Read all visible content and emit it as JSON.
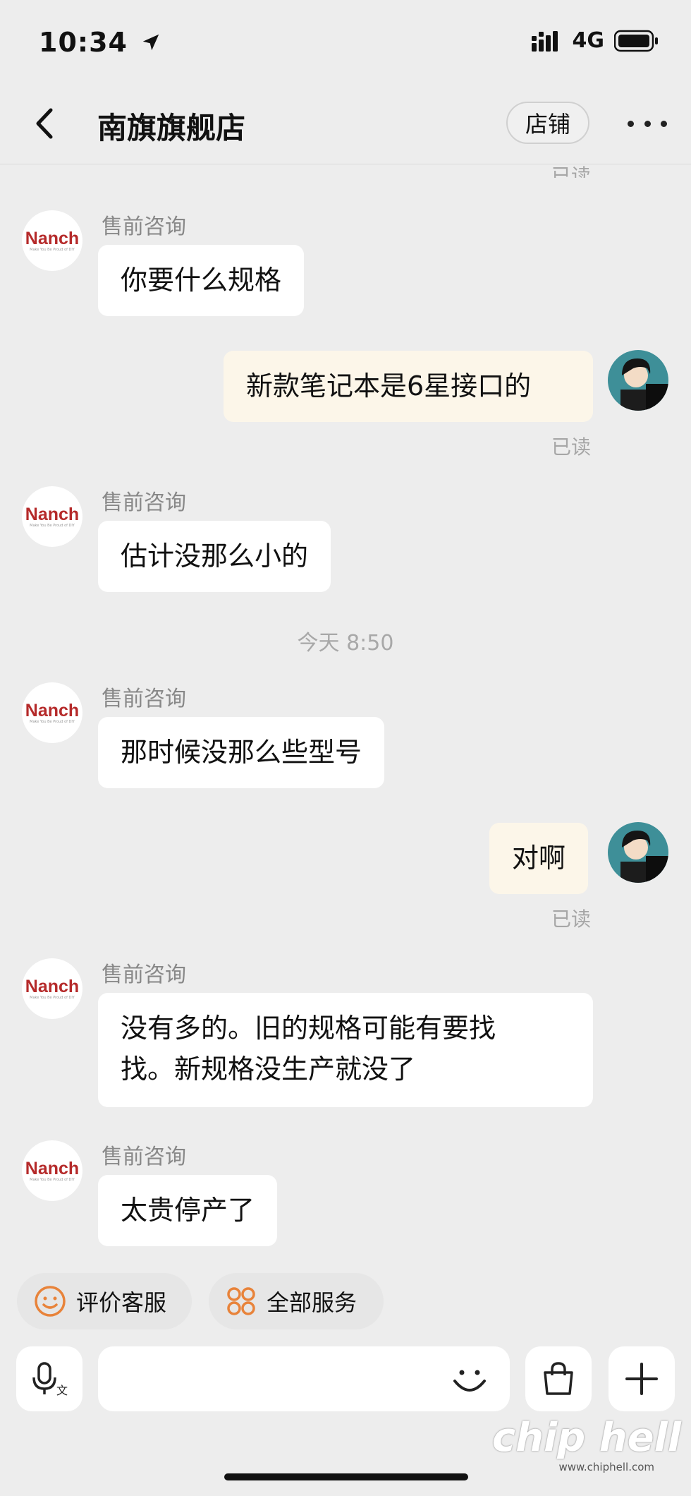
{
  "status_bar": {
    "time": "10:34",
    "network": "4G"
  },
  "nav": {
    "title": "南旗旗舰店",
    "shop_button": "店铺"
  },
  "top_read": "已读",
  "messages": [
    {
      "side": "left",
      "sender": "售前咨询",
      "text": "你要什么规格"
    },
    {
      "side": "right",
      "text": "新款笔记本是6星接口的",
      "status": "已读"
    },
    {
      "side": "left",
      "sender": "售前咨询",
      "text": "估计没那么小的"
    },
    {
      "side": "left",
      "sender": "售前咨询",
      "text": "那时候没那么些型号"
    },
    {
      "side": "right",
      "text": "对啊",
      "status": "已读"
    },
    {
      "side": "left",
      "sender": "售前咨询",
      "text_line1": "没有多的。旧的规格可能有要找",
      "text_line2": "找。新规格没生产就没了"
    },
    {
      "side": "left",
      "sender": "售前咨询",
      "text": "太贵停产了"
    }
  ],
  "timestamp": "今天 8:50",
  "shop_avatar": {
    "logo": "Nanch",
    "tagline": "Make You Be Proud of DIY"
  },
  "quick_actions": {
    "rate": "评价客服",
    "services": "全部服务"
  },
  "icons": {
    "voice": "voice-translate-icon",
    "emoji": "emoji-icon",
    "bag": "shopping-bag-icon",
    "plus": "plus-icon"
  },
  "watermark": {
    "text": "chip hell",
    "url": "www.chiphell.com"
  },
  "colors": {
    "bubble_self": "#fcf6e9",
    "bubble_other": "#ffffff",
    "accent": "#e8833a",
    "logo_red": "#b52a2a"
  }
}
